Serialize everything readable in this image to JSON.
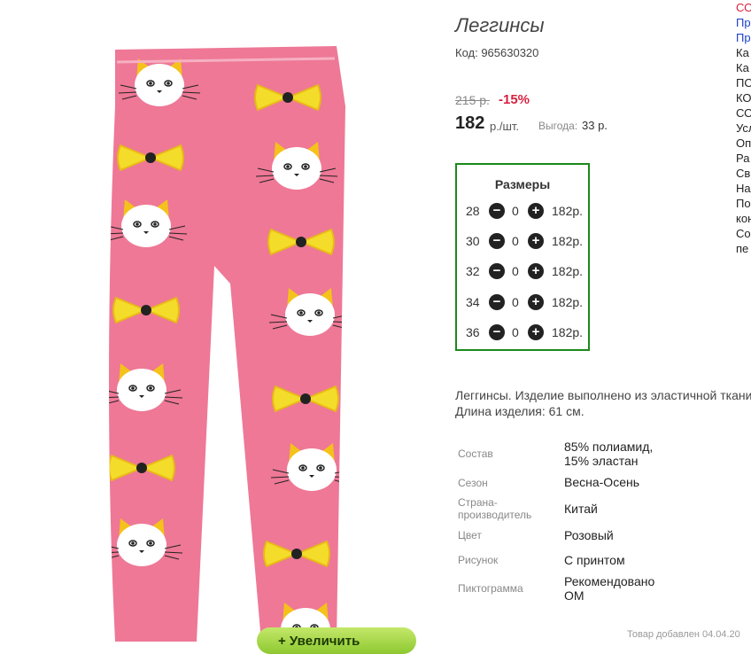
{
  "product": {
    "title": "Леггинсы",
    "code": "Код: 965630320",
    "old_price": "215 р.",
    "discount": "-15%",
    "price": "182",
    "price_unit": "р./шт.",
    "benefit_label": "Выгода:",
    "benefit_value": "33 р."
  },
  "sizes": {
    "title": "Размеры",
    "rows": [
      {
        "size": "28",
        "qty": "0",
        "price": "182р."
      },
      {
        "size": "30",
        "qty": "0",
        "price": "182р."
      },
      {
        "size": "32",
        "qty": "0",
        "price": "182р."
      },
      {
        "size": "34",
        "qty": "0",
        "price": "182р."
      },
      {
        "size": "36",
        "qty": "0",
        "price": "182р."
      }
    ]
  },
  "description": {
    "line1": "Леггинсы. Изделие выполнено из эластичной ткани",
    "line2": "Длина изделия: 61 см."
  },
  "properties": [
    {
      "label": "Состав",
      "value1": "85% полиамид,",
      "value2": "15% эластан"
    },
    {
      "label": "Сезон",
      "value1": "Весна-Осень"
    },
    {
      "label1": "Страна-",
      "label2": "производитель",
      "value1": "Китай"
    },
    {
      "label": "Цвет",
      "value1": "Розовый"
    },
    {
      "label": "Рисунок",
      "value1": "С принтом"
    },
    {
      "label": "Пиктограмма",
      "value1": "Рекомендовано",
      "value2": "ОМ"
    }
  ],
  "right_links": [
    "СО",
    "Пр",
    "Пр",
    "Ка",
    "Ка",
    "ПО",
    "КО",
    "СО",
    "Усл",
    "Оп",
    "Ра",
    "Св",
    "На",
    "По",
    "кон",
    "Со",
    "пе"
  ],
  "footer": {
    "added": "Товар добавлен 04.04.20",
    "zoom_label": "+ Увеличить"
  },
  "colors": {
    "accent_red": "#d8213f",
    "frame_green": "#1a8a1a",
    "link_blue": "#1a3fc8",
    "pants_pink": "#ee7896",
    "bow_yellow": "#f4dc2a"
  },
  "icons": [
    "minus-circle-icon",
    "plus-circle-icon"
  ]
}
